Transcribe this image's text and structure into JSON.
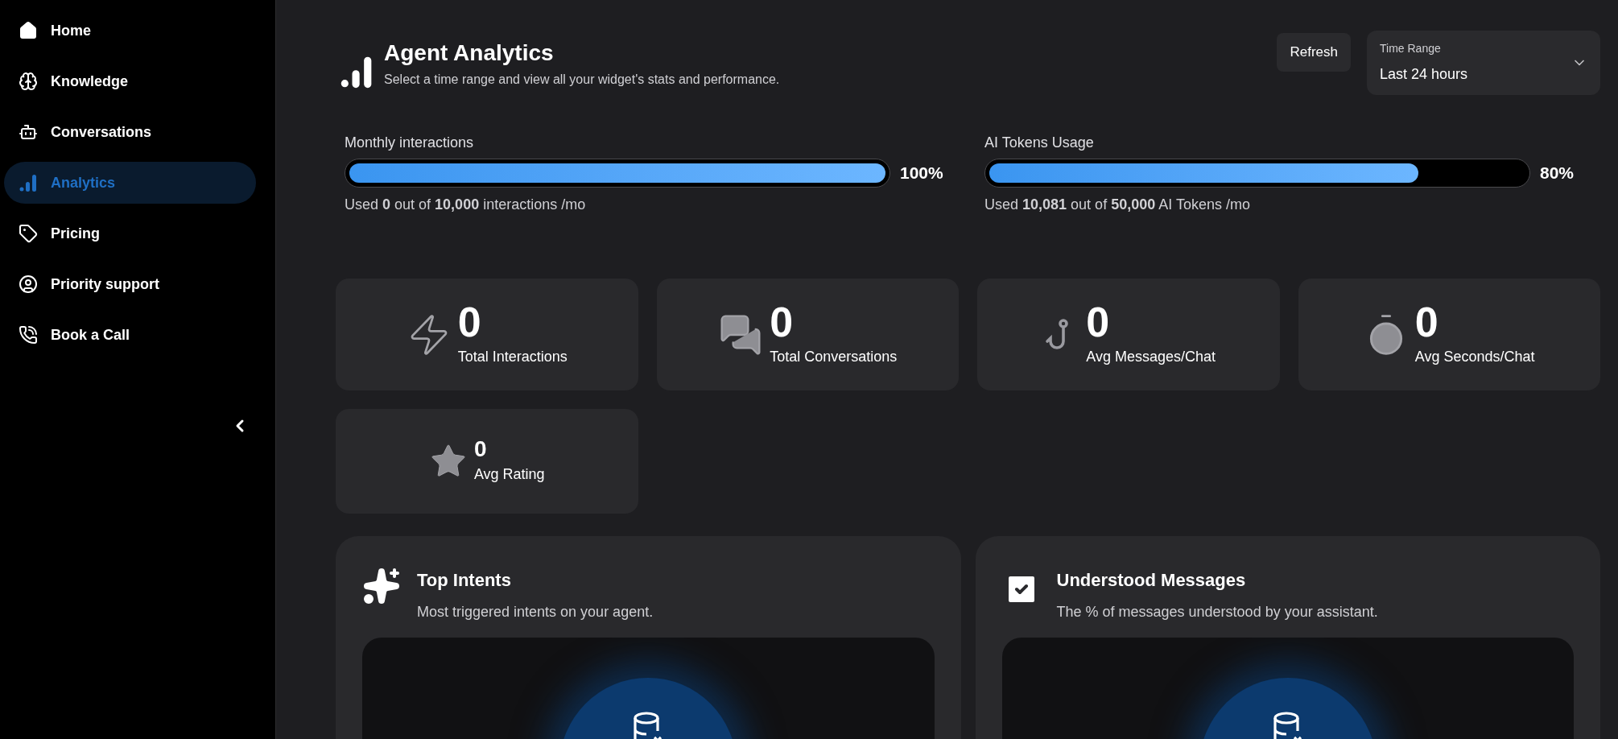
{
  "sidebar": {
    "items": [
      {
        "label": "Home",
        "selected": false
      },
      {
        "label": "Knowledge",
        "selected": false
      },
      {
        "label": "Conversations",
        "selected": false
      },
      {
        "label": "Analytics",
        "selected": true
      },
      {
        "label": "Pricing",
        "selected": false
      },
      {
        "label": "Priority support",
        "selected": false
      },
      {
        "label": "Book a Call",
        "selected": false
      }
    ]
  },
  "header": {
    "title": "Agent Analytics",
    "subtitle": "Select a time range and view all your widget's stats and performance.",
    "refresh_button": "Refresh",
    "time_range": {
      "label": "Time Range",
      "value": "Last 24 hours"
    }
  },
  "usage": [
    {
      "title": "Monthly interactions",
      "level": 1,
      "percent": "100%",
      "caption": "Used **0** out of **10,000** interactions /mo"
    },
    {
      "title": "AI Tokens Usage",
      "level": 0.8,
      "percent": "80%",
      "caption": "Used **10,081** out of **50,000** AI Tokens /mo"
    }
  ],
  "stats": [
    {
      "value": "0",
      "label": "Total Interactions"
    },
    {
      "value": "0",
      "label": "Total Conversations"
    },
    {
      "value": "0",
      "label": "Avg Messages/Chat"
    },
    {
      "value": "0",
      "label": "Avg Seconds/Chat"
    },
    {
      "value": "0",
      "label": "Avg Rating"
    }
  ],
  "panels": [
    {
      "title": "Top Intents",
      "subtitle": "Most triggered intents on your agent."
    },
    {
      "title": "Understood Messages",
      "subtitle": "The % of messages understood by your assistant."
    }
  ]
}
